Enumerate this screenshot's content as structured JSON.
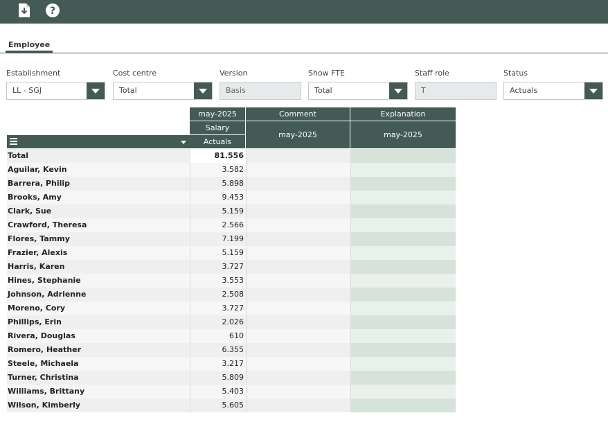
{
  "toolbar": {
    "export_icon": "export-download-icon",
    "help_icon": "help-question-icon",
    "accent": "#435a55"
  },
  "tabs": [
    {
      "label": "Employee",
      "active": true
    }
  ],
  "filters": {
    "establishment": {
      "label": "Establishment",
      "value": "LL - SGJ"
    },
    "cost_centre": {
      "label": "Cost centre",
      "value": "Total"
    },
    "version": {
      "label": "Version",
      "value": "Basis"
    },
    "show_fte": {
      "label": "Show FTE",
      "value": "Total"
    },
    "staff_role": {
      "label": "Staff role",
      "value": "T"
    },
    "status": {
      "label": "Status",
      "value": "Actuals"
    }
  },
  "grid": {
    "headers": {
      "month": "may-2025",
      "salary": "Salary",
      "actuals": "Actuals",
      "comment": "Comment",
      "comment_month": "may-2025",
      "explanation": "Explanation",
      "explanation_month": "may-2025"
    },
    "rows": [
      {
        "name": "Total",
        "value": "81.556"
      },
      {
        "name": "Aguilar, Kevin",
        "value": "3.582"
      },
      {
        "name": "Barrera, Philip",
        "value": "5.898"
      },
      {
        "name": "Brooks, Amy",
        "value": "9.453"
      },
      {
        "name": "Clark, Sue",
        "value": "5.159"
      },
      {
        "name": "Crawford, Theresa",
        "value": "2.566"
      },
      {
        "name": "Flores, Tammy",
        "value": "7.199"
      },
      {
        "name": "Frazier, Alexis",
        "value": "5.159"
      },
      {
        "name": "Harris, Karen",
        "value": "3.727"
      },
      {
        "name": "Hines, Stephanie",
        "value": "3.553"
      },
      {
        "name": "Johnson, Adrienne",
        "value": "2.508"
      },
      {
        "name": "Moreno, Cory",
        "value": "3.727"
      },
      {
        "name": "Phillips, Erin",
        "value": "2.026"
      },
      {
        "name": "Rivera, Douglas",
        "value": "610"
      },
      {
        "name": "Romero, Heather",
        "value": "6.355"
      },
      {
        "name": "Steele, Michaela",
        "value": "3.217"
      },
      {
        "name": "Turner, Christina",
        "value": "5.809"
      },
      {
        "name": "Williams, Brittany",
        "value": "5.403"
      },
      {
        "name": "Wilson, Kimberly",
        "value": "5.605"
      }
    ]
  }
}
